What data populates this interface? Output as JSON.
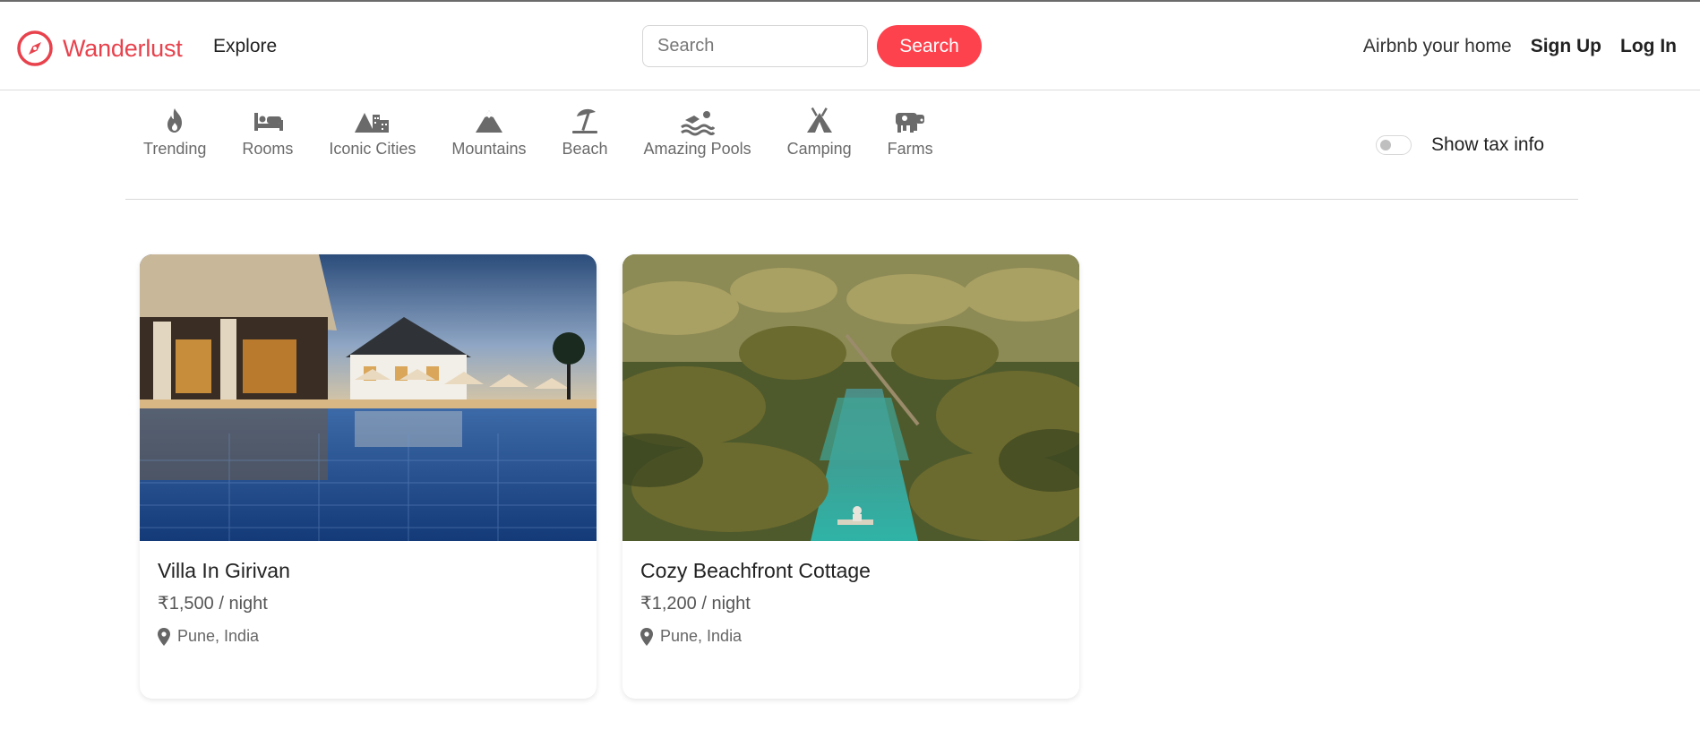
{
  "navbar": {
    "brand": "Wanderlust",
    "explore": "Explore",
    "search_placeholder": "Search",
    "search_button": "Search",
    "host_link": "Airbnb your home",
    "signup": "Sign Up",
    "login": "Log In",
    "brand_color": "#e8424d"
  },
  "filters": [
    {
      "label": "Trending",
      "icon": "fire-icon"
    },
    {
      "label": "Rooms",
      "icon": "bed-icon"
    },
    {
      "label": "Iconic Cities",
      "icon": "mountain-city-icon"
    },
    {
      "label": "Mountains",
      "icon": "mountain-icon"
    },
    {
      "label": "Beach",
      "icon": "umbrella-beach-icon"
    },
    {
      "label": "Amazing Pools",
      "icon": "swimmer-icon"
    },
    {
      "label": "Camping",
      "icon": "tent-icon"
    },
    {
      "label": "Farms",
      "icon": "cow-icon"
    }
  ],
  "tax_toggle": {
    "label": "Show tax info",
    "checked": false
  },
  "listings": [
    {
      "title": "Villa In Girivan",
      "price": "₹1,500 / night",
      "location": "Pune, India",
      "image": "resort-pool-photo"
    },
    {
      "title": "Cozy Beachfront Cottage",
      "price": "₹1,200 / night",
      "location": "Pune, India",
      "image": "palm-lagoon-photo"
    }
  ]
}
